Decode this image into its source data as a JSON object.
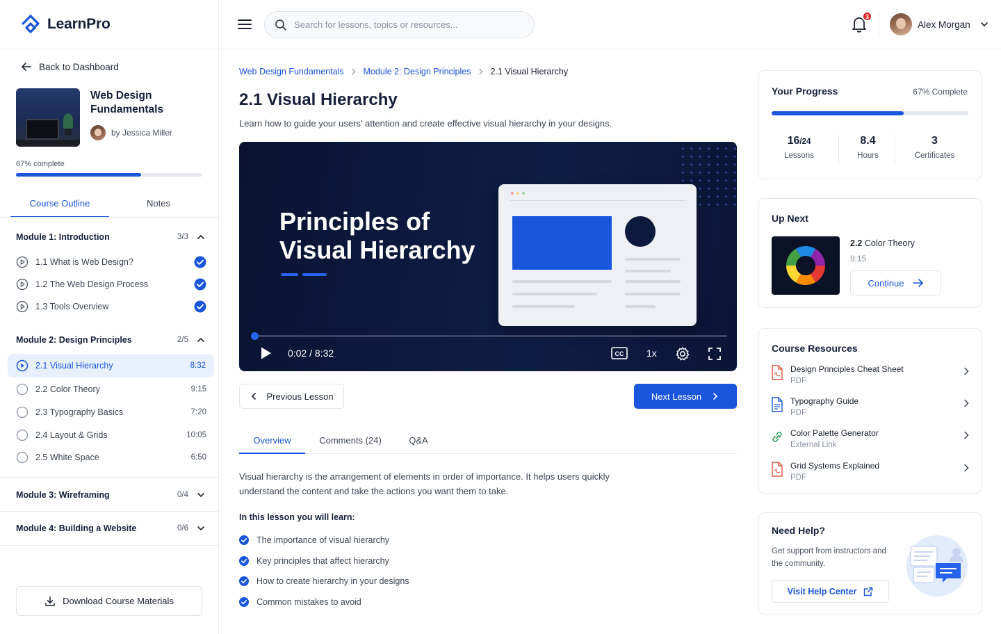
{
  "app": {
    "name": "LearnPro"
  },
  "header": {
    "search_placeholder": "Search for lessons, topics or resources...",
    "notifications_count": "3",
    "user_name": "Alex Morgan"
  },
  "sidebar": {
    "back_label": "Back to Dashboard",
    "course_title": "Web Design Fundamentals",
    "author": "by Jessica Miller",
    "progress_label": "67% complete",
    "progress_fraction": 0.67,
    "tabs": [
      "Course Outline",
      "Notes"
    ],
    "modules": [
      {
        "title": "Module 1: Introduction",
        "count": "3/3",
        "expanded": true,
        "lessons": [
          {
            "name": "1.1 What is Web Design?",
            "done": true
          },
          {
            "name": "1.2 The Web Design Process",
            "done": true
          },
          {
            "name": "1.3 Tools Overview",
            "done": true
          }
        ]
      },
      {
        "title": "Module 2: Design Principles",
        "count": "2/5",
        "expanded": true,
        "lessons": [
          {
            "name": "2.1 Visual Hierarchy",
            "duration": "8:32",
            "active": true
          },
          {
            "name": "2.2 Color Theory",
            "duration": "9:15"
          },
          {
            "name": "2.3 Typography Basics",
            "duration": "7:20"
          },
          {
            "name": "2.4 Layout & Grids",
            "duration": "10:05"
          },
          {
            "name": "2.5 White Space",
            "duration": "6:50"
          }
        ]
      },
      {
        "title": "Module 3: Wireframing",
        "count": "0/4",
        "expanded": false
      },
      {
        "title": "Module 4: Building a Website",
        "count": "0/6",
        "expanded": false
      }
    ],
    "download_label": "Download Course Materials"
  },
  "main": {
    "breadcrumb": [
      "Web Design Fundamentals",
      "Module 2: Design Principles",
      "2.1 Visual Hierarchy"
    ],
    "title": "2.1 Visual Hierarchy",
    "subtitle": "Learn how to guide your users' attention and create effective visual hierarchy in your designs.",
    "video": {
      "title_line1": "Principles of",
      "title_line2": "Visual Hierarchy",
      "time": "0:02 / 8:32",
      "speed": "1x",
      "progress_fraction": 0.004
    },
    "prev_label": "Previous Lesson",
    "next_label": "Next Lesson",
    "tabs": [
      "Overview",
      "Comments (24)",
      "Q&A"
    ],
    "overview_text": "Visual hierarchy is the arrangement of elements in order of importance. It helps users quickly understand the content and take the actions you want them to take.",
    "learn_heading": "In this lesson you will learn:",
    "learn_items": [
      "The importance of visual hierarchy",
      "Key principles that affect hierarchy",
      "How to create hierarchy in your designs",
      "Common mistakes to avoid"
    ]
  },
  "right": {
    "progress": {
      "heading": "Your Progress",
      "pct_label": "67% Complete",
      "fraction": 0.67,
      "lessons_value": "16",
      "lessons_total": "/24",
      "lessons_label": "Lessons",
      "hours_value": "8.4",
      "hours_label": "Hours",
      "certs_value": "3",
      "certs_label": "Certificates"
    },
    "up_next": {
      "heading": "Up Next",
      "number": "2.2",
      "name": "Color Theory",
      "duration": "9:15",
      "continue_label": "Continue"
    },
    "resources": {
      "heading": "Course Resources",
      "items": [
        {
          "name": "Design Principles Cheat Sheet",
          "kind": "PDF",
          "icon": "pdf-icon"
        },
        {
          "name": "Typography Guide",
          "kind": "PDF",
          "icon": "document-icon"
        },
        {
          "name": "Color Palette Generator",
          "kind": "External Link",
          "icon": "link-icon"
        },
        {
          "name": "Grid Systems Explained",
          "kind": "PDF",
          "icon": "pdf-icon"
        }
      ]
    },
    "help": {
      "heading": "Need Help?",
      "text": "Get support from instructors and the community.",
      "button_label": "Visit Help Center"
    }
  },
  "colors": {
    "accent": "#1a56db",
    "badge": "#e02424",
    "success": "#1a56db"
  }
}
